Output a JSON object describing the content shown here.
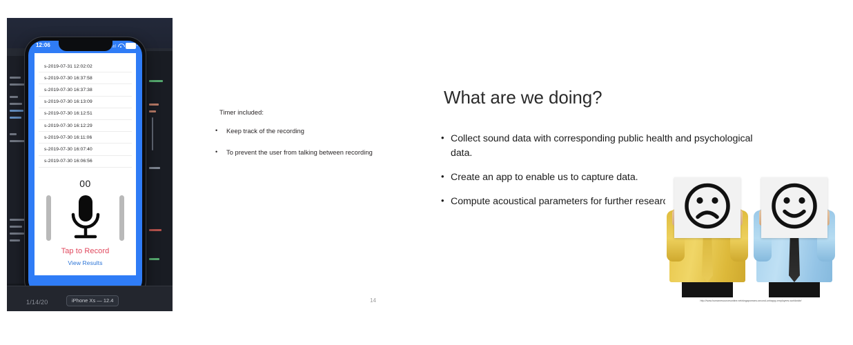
{
  "slide_left": {
    "simulator": {
      "status_time": "12:06",
      "recordings": [
        "s-2019-07-31 12:02:02",
        "s-2019-07-30 16:37:58",
        "s-2019-07-30 16:37:38",
        "s-2019-07-30 16:13:09",
        "s-2019-07-30 16:12:51",
        "s-2019-07-30 16:12:29",
        "s-2019-07-30 16:11:06",
        "s-2019-07-30 16:07:40",
        "s-2019-07-30 16:06:56"
      ],
      "timer_value": "00",
      "record_label": "Tap to Record",
      "view_results_label": "View Results",
      "record_label_color": "#e0475c",
      "view_results_color": "#2a73d6",
      "accent_color": "#2f7cf6",
      "ide_date": "1/14/20",
      "device_label": "iPhone Xs — 12.4"
    },
    "text": {
      "lead": "Timer included:",
      "bullets": [
        "Keep track of the recording",
        "To prevent the user from talking between recording"
      ]
    },
    "page_number": "14"
  },
  "slide_right": {
    "title": "What are we doing?",
    "bullets": [
      "Collect sound data with corresponding public health and psychological data.",
      "Create an app to enable us to capture data.",
      "Compute acoustical parameters for further research."
    ],
    "photo": {
      "left_person": {
        "shirt_color": "#e8c64a",
        "tie_color": "#d9b63a",
        "expression": "sad-face"
      },
      "right_person": {
        "shirt_color": "#a9d3ee",
        "tie_color": "#1d1d1d",
        "expression": "happy-face"
      },
      "credit": "http://www.humanresourcesonline.net/singaporeans-second-unhappy-employees-worldwide/"
    }
  }
}
